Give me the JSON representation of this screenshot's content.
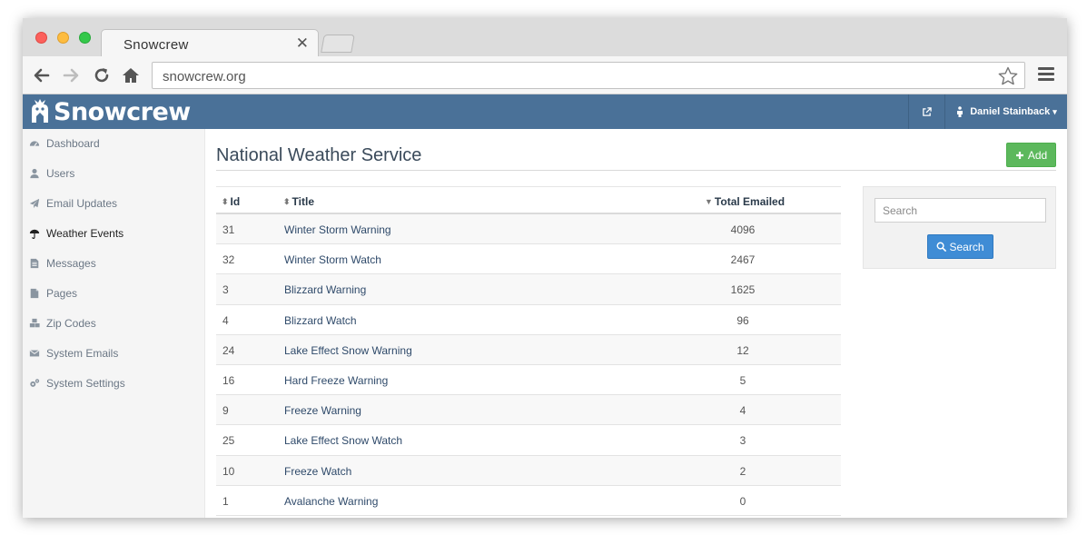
{
  "browser": {
    "tab_title": "Snowcrew",
    "tab_close_glyph": "✕",
    "url": "snowcrew.org"
  },
  "app": {
    "logo_text": "Snowcrew",
    "user_name": "Daniel Stainback",
    "user_caret": "▾",
    "brand_color": "#4a7198"
  },
  "sidebar": {
    "items": [
      {
        "label": "Dashboard",
        "icon": "dashboard-icon"
      },
      {
        "label": "Users",
        "icon": "user-icon"
      },
      {
        "label": "Email Updates",
        "icon": "paper-plane-icon"
      },
      {
        "label": "Weather Events",
        "icon": "umbrella-icon",
        "active": true
      },
      {
        "label": "Messages",
        "icon": "file-text-icon"
      },
      {
        "label": "Pages",
        "icon": "file-icon"
      },
      {
        "label": "Zip Codes",
        "icon": "cubes-icon"
      },
      {
        "label": "System Emails",
        "icon": "envelope-icon"
      },
      {
        "label": "System Settings",
        "icon": "cogs-icon"
      }
    ]
  },
  "main": {
    "title": "National Weather Service",
    "add_label": "Add",
    "table": {
      "columns": [
        "Id",
        "Title",
        "Total Emailed"
      ],
      "rows": [
        {
          "id": "31",
          "title": "Winter Storm Warning",
          "total": "4096"
        },
        {
          "id": "32",
          "title": "Winter Storm Watch",
          "total": "2467"
        },
        {
          "id": "3",
          "title": "Blizzard Warning",
          "total": "1625"
        },
        {
          "id": "4",
          "title": "Blizzard Watch",
          "total": "96"
        },
        {
          "id": "24",
          "title": "Lake Effect Snow Warning",
          "total": "12"
        },
        {
          "id": "16",
          "title": "Hard Freeze Warning",
          "total": "5"
        },
        {
          "id": "9",
          "title": "Freeze Warning",
          "total": "4"
        },
        {
          "id": "25",
          "title": "Lake Effect Snow Watch",
          "total": "3"
        },
        {
          "id": "10",
          "title": "Freeze Watch",
          "total": "2"
        },
        {
          "id": "1",
          "title": "Avalanche Warning",
          "total": "0"
        }
      ]
    },
    "search": {
      "placeholder": "Search",
      "button_label": "Search"
    }
  }
}
